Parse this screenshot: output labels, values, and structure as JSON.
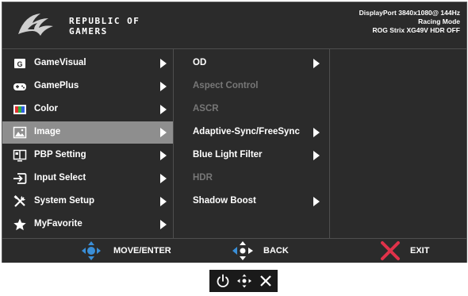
{
  "header": {
    "brand_line1": "REPUBLIC OF",
    "brand_line2": "GAMERS",
    "status_line1": "DisplayPort 3840x1080@ 144Hz",
    "status_line2": "Racing Mode",
    "status_line3": "ROG Strix XG49V HDR OFF"
  },
  "main_menu": {
    "items": [
      {
        "label": "GameVisual",
        "icon": "gamevisual-icon"
      },
      {
        "label": "GamePlus",
        "icon": "gamepad-icon"
      },
      {
        "label": "Color",
        "icon": "color-icon"
      },
      {
        "label": "Image",
        "icon": "image-icon",
        "selected": true
      },
      {
        "label": "PBP Setting",
        "icon": "pbp-icon"
      },
      {
        "label": "Input Select",
        "icon": "input-icon"
      },
      {
        "label": "System Setup",
        "icon": "tools-icon"
      },
      {
        "label": "MyFavorite",
        "icon": "star-icon"
      }
    ]
  },
  "sub_menu": {
    "items": [
      {
        "label": "OD",
        "enabled": true,
        "has_arrow": true
      },
      {
        "label": "Aspect Control",
        "enabled": false,
        "has_arrow": false
      },
      {
        "label": "ASCR",
        "enabled": false,
        "has_arrow": false
      },
      {
        "label": "Adaptive-Sync/FreeSync",
        "enabled": true,
        "has_arrow": true
      },
      {
        "label": "Blue Light Filter",
        "enabled": true,
        "has_arrow": true
      },
      {
        "label": "HDR",
        "enabled": false,
        "has_arrow": false
      },
      {
        "label": "Shadow Boost",
        "enabled": true,
        "has_arrow": true
      }
    ]
  },
  "footer": {
    "move_label": "MOVE/ENTER",
    "back_label": "BACK",
    "exit_label": "EXIT"
  },
  "colors": {
    "accent_blue": "#3a8fd8",
    "exit_red": "#e0324a",
    "selected_bg": "#8e8e8e",
    "osd_bg": "#2b2b2b"
  }
}
